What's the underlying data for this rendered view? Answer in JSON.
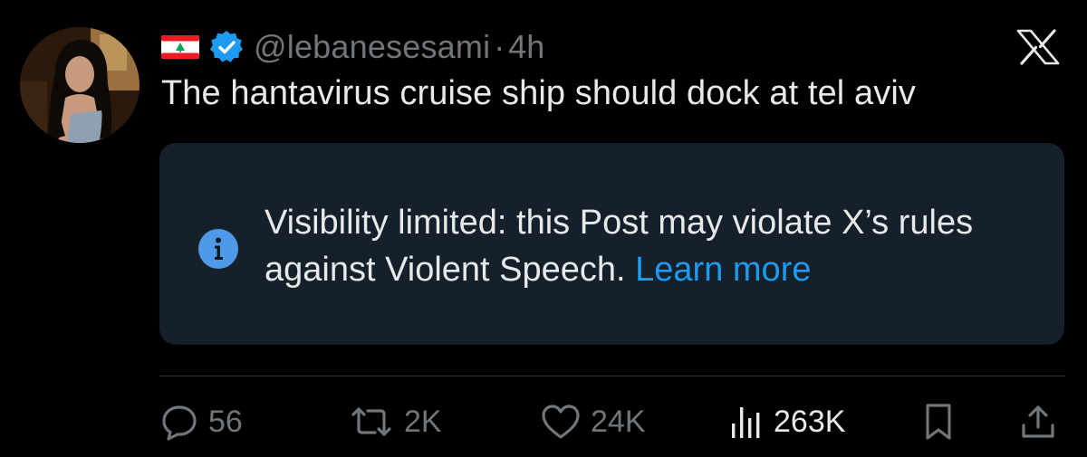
{
  "post": {
    "author": {
      "flag_icon": "lebanon-flag-icon",
      "verified_icon": "verified-badge-icon",
      "handle": "@lebanesesami",
      "separator": "·",
      "time": "4h"
    },
    "text": "The hantavirus cruise ship should dock at tel aviv",
    "notice": {
      "icon": "info-icon",
      "message": "Visibility limited: this Post may violate X’s rules against Violent Speech.",
      "link": "Learn more"
    },
    "actions": {
      "replies": "56",
      "reposts": "2K",
      "likes": "24K",
      "views": "263K"
    }
  },
  "brand": {
    "logo_icon": "x-logo-icon",
    "colors": {
      "background": "#000000",
      "text": "#e7e9ea",
      "muted": "#71767b",
      "accent": "#1d9bf0",
      "notice_bg": "#16202a"
    }
  }
}
